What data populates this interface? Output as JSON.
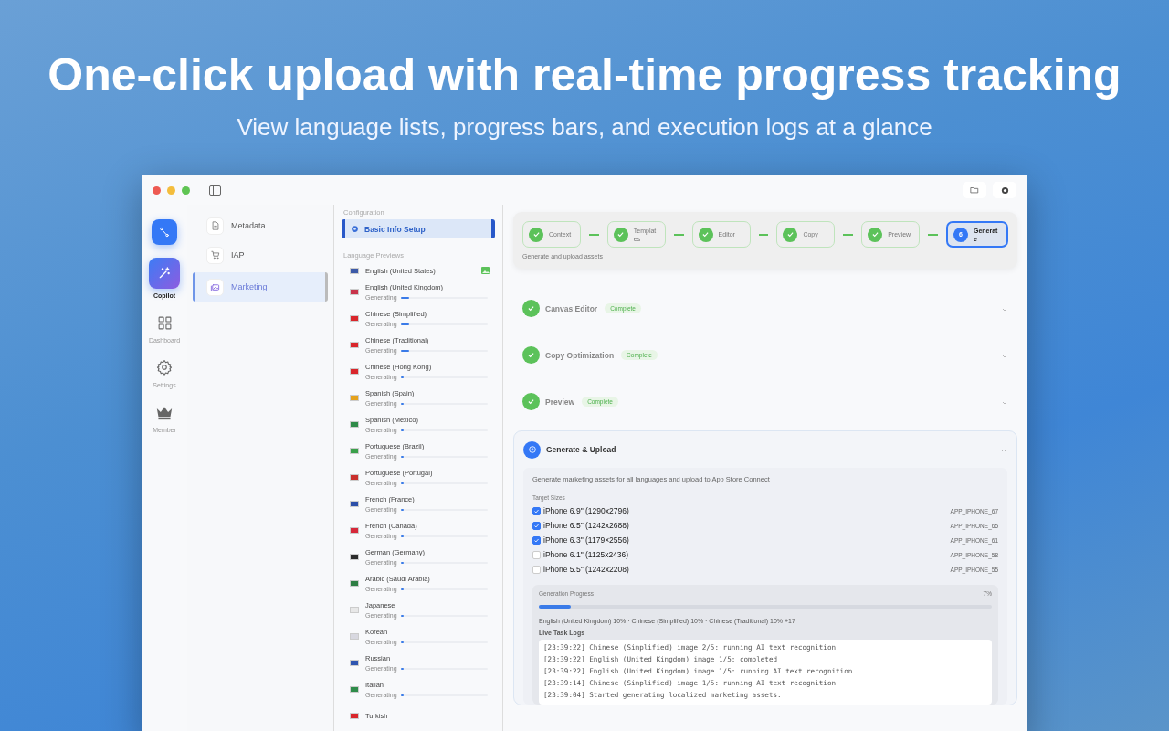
{
  "headline": "One-click upload with real-time progress tracking",
  "subheadline": "View language lists, progress bars, and execution logs at a glance",
  "rail": [
    {
      "kind": "flow",
      "selected": false
    },
    {
      "label": "Copilot",
      "kind": "wand",
      "selected": true
    },
    {
      "label": "Dashboard",
      "kind": "grid",
      "selected": false
    },
    {
      "label": "Settings",
      "kind": "gear",
      "selected": false
    },
    {
      "label": "Member",
      "kind": "crown",
      "selected": false
    }
  ],
  "modules": [
    {
      "label": "Metadata",
      "kind": "doc",
      "selected": false
    },
    {
      "label": "IAP",
      "kind": "cart",
      "selected": false
    },
    {
      "label": "Marketing",
      "kind": "images",
      "selected": true
    }
  ],
  "configuration": {
    "heading": "Configuration",
    "item": "Basic Info Setup"
  },
  "languages_heading": "Language Previews",
  "languages": [
    {
      "name": "English (United States)",
      "kind": "done",
      "color": "#3c5aa8"
    },
    {
      "name": "English (United Kingdom)",
      "kind": "generating",
      "status": "Generating",
      "level": 0.1,
      "color": "#c8334a"
    },
    {
      "name": "Chinese (Simplified)",
      "kind": "generating",
      "status": "Generating",
      "level": 0.1,
      "color": "#d9262b"
    },
    {
      "name": "Chinese (Traditional)",
      "kind": "generating",
      "status": "Generating",
      "level": 0.1,
      "color": "#d9262b"
    },
    {
      "name": "Chinese (Hong Kong)",
      "kind": "generating",
      "status": "Generating",
      "level": 0.03,
      "color": "#d9262b"
    },
    {
      "name": "Spanish (Spain)",
      "kind": "generating",
      "status": "Generating",
      "level": 0.03,
      "color": "#e5a21c"
    },
    {
      "name": "Spanish (Mexico)",
      "kind": "generating",
      "status": "Generating",
      "level": 0.03,
      "color": "#2f8a48"
    },
    {
      "name": "Portuguese (Brazil)",
      "kind": "generating",
      "status": "Generating",
      "level": 0.03,
      "color": "#3aa04a"
    },
    {
      "name": "Portuguese (Portugal)",
      "kind": "generating",
      "status": "Generating",
      "level": 0.03,
      "color": "#c9302c"
    },
    {
      "name": "French (France)",
      "kind": "generating",
      "status": "Generating",
      "level": 0.03,
      "color": "#2d4fa8"
    },
    {
      "name": "French (Canada)",
      "kind": "generating",
      "status": "Generating",
      "level": 0.03,
      "color": "#d6283a"
    },
    {
      "name": "German (Germany)",
      "kind": "generating",
      "status": "Generating",
      "level": 0.03,
      "color": "#2b2b2b"
    },
    {
      "name": "Arabic (Saudi Arabia)",
      "kind": "generating",
      "status": "Generating",
      "level": 0.03,
      "color": "#2e7d43"
    },
    {
      "name": "Japanese",
      "kind": "generating",
      "status": "Generating",
      "level": 0.03,
      "color": "#e8e8e8"
    },
    {
      "name": "Korean",
      "kind": "generating",
      "status": "Generating",
      "level": 0.03,
      "color": "#d8d8e0"
    },
    {
      "name": "Russian",
      "kind": "generating",
      "status": "Generating",
      "level": 0.03,
      "color": "#2f55b0"
    },
    {
      "name": "Italian",
      "kind": "generating",
      "status": "Generating",
      "level": 0.03,
      "color": "#2e8c4a"
    },
    {
      "name": "Turkish",
      "kind": "cut",
      "color": "#d9262b"
    }
  ],
  "steps": [
    {
      "label": "Context",
      "selected": false
    },
    {
      "label": "Templates",
      "selected": false
    },
    {
      "label": "Editor",
      "selected": false
    },
    {
      "label": "Copy",
      "selected": false
    },
    {
      "label": "Preview",
      "selected": false
    },
    {
      "label": "Generate",
      "selected": true,
      "number": "6"
    }
  ],
  "step_caption": "Generate and upload assets",
  "sections": [
    {
      "title": "Canvas Editor",
      "badge": "Complete",
      "expanded": false
    },
    {
      "title": "Copy Optimization",
      "badge": "Complete",
      "expanded": false
    },
    {
      "title": "Preview",
      "badge": "Complete",
      "expanded": false
    }
  ],
  "generate": {
    "title": "Generate & Upload",
    "expanded": true,
    "description": "Generate marketing assets for all languages and upload to App Store Connect",
    "sizes_heading": "Target Sizes",
    "sizes": [
      {
        "label": "iPhone 6.9\" (1290x2796)",
        "code": "APP_IPHONE_67",
        "checked": true
      },
      {
        "label": "iPhone 6.5\" (1242x2688)",
        "code": "APP_IPHONE_65",
        "checked": true
      },
      {
        "label": "iPhone 6.3\" (1179×2556)",
        "code": "APP_IPHONE_61",
        "checked": true
      },
      {
        "label": "iPhone 6.1\" (1125x2436)",
        "code": "APP_IPHONE_58",
        "checked": false
      },
      {
        "label": "iPhone 5.5\" (1242x2208)",
        "code": "APP_IPHONE_55",
        "checked": false
      }
    ],
    "progress": {
      "title": "Generation Progress",
      "percent": "7%",
      "level": 0.07,
      "summary": "English (United Kingdom) 10% · Chinese (Simplified) 10% · Chinese (Traditional) 10% +17"
    },
    "logs_heading": "Live Task Logs",
    "logs": [
      "[23:39:22] Chinese (Simplified) image 2/5: running AI text recognition",
      "[23:39:22] English (United Kingdom) image 1/5: completed",
      "[23:39:22] English (United Kingdom) image 1/5: running AI text recognition",
      "[23:39:14] Chinese (Simplified) image 1/5: running AI text recognition",
      "[23:39:04] Started generating localized marketing assets."
    ]
  }
}
